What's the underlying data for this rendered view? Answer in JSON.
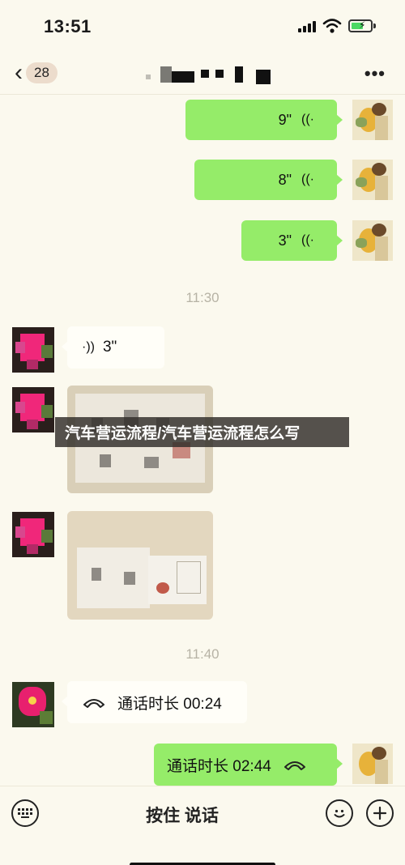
{
  "status_bar": {
    "time": "13:51"
  },
  "header": {
    "back_icon": "chevron-left-icon",
    "unread_count": "28",
    "more_icon": "more-icon"
  },
  "messages": {
    "voice_out_1": {
      "duration": "9\""
    },
    "voice_out_2": {
      "duration": "8\""
    },
    "voice_out_3": {
      "duration": "3\""
    },
    "time_1": "11:30",
    "voice_in_1": {
      "duration": "3\""
    },
    "time_2": "11:40",
    "call_in": {
      "text": "通话时长 00:24"
    },
    "call_out": {
      "text": "通话时长 02:44"
    }
  },
  "watermark": "汽车营运流程/汽车营运流程怎么写",
  "input_bar": {
    "keyboard_icon": "keyboard-icon",
    "hold_to_talk": "按住 说话",
    "emoji_icon": "emoji-icon",
    "plus_icon": "plus-icon"
  },
  "colors": {
    "outgoing_bubble": "#95ec69",
    "incoming_bubble": "#fffef8",
    "background": "#fbf9ee"
  }
}
